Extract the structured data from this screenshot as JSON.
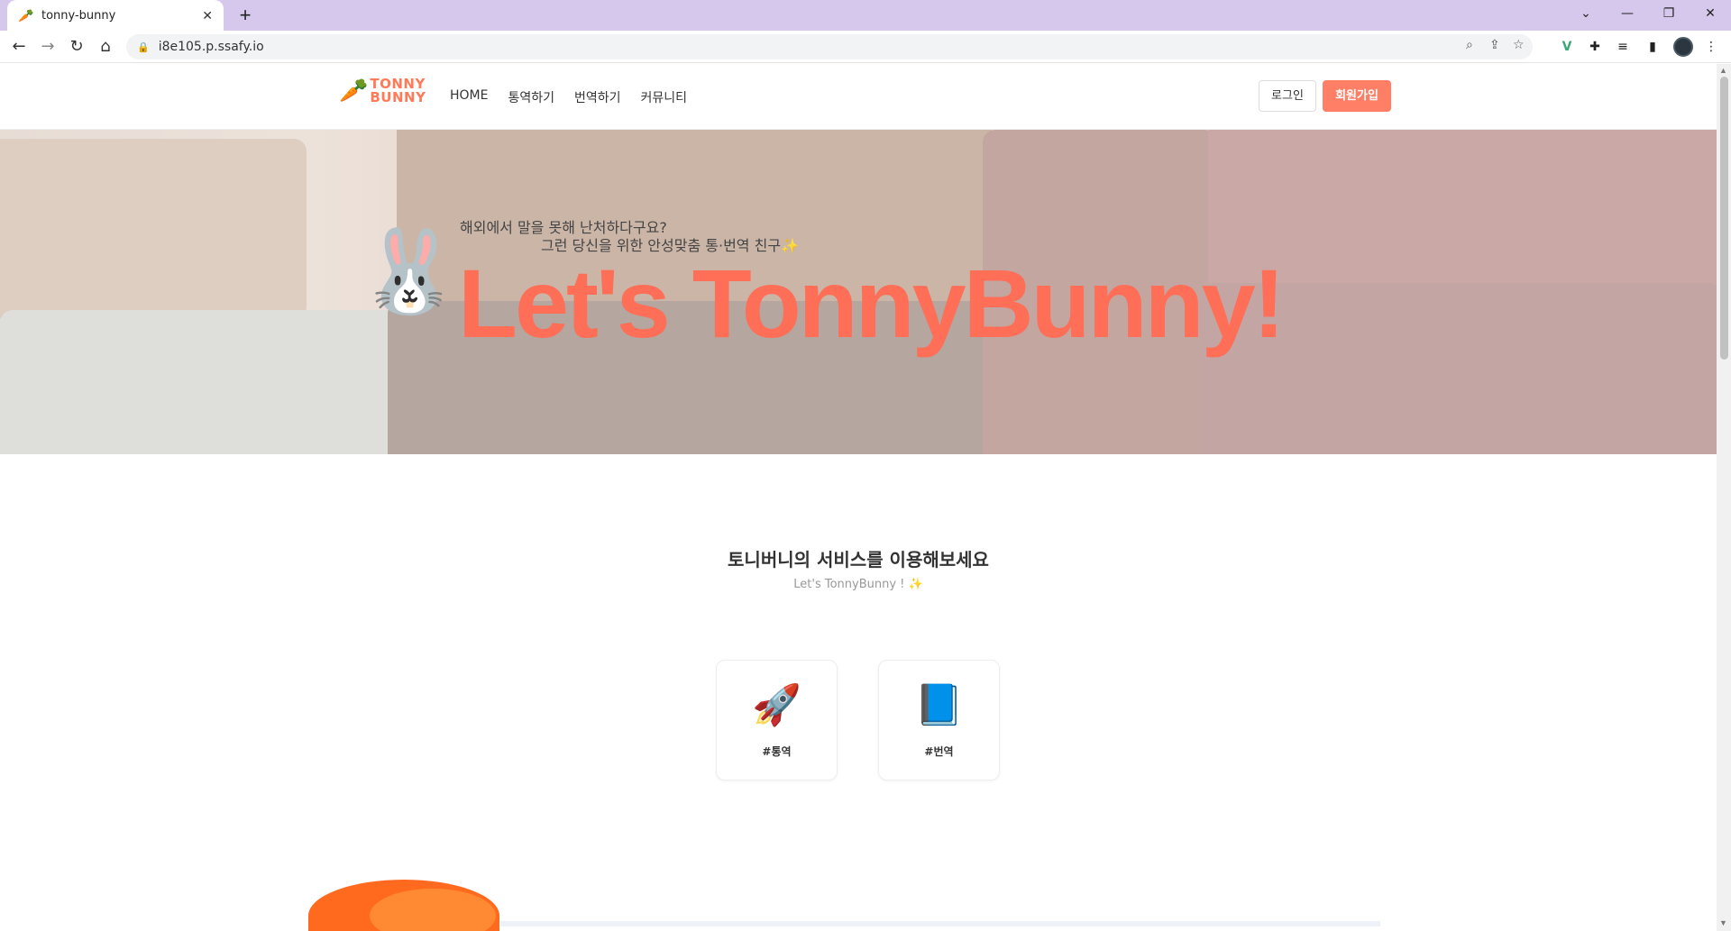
{
  "browser": {
    "tab_title": "tonny-bunny",
    "tab_favicon": "🥕",
    "url": "i8e105.p.ssafy.io"
  },
  "header": {
    "logo_line1": "TONNY",
    "logo_line2": "BUNNY",
    "nav": [
      "HOME",
      "통역하기",
      "번역하기",
      "커뮤니티"
    ],
    "login_label": "로그인",
    "signup_label": "회원가입"
  },
  "hero": {
    "subtitle1": "해외에서 말을 못해 난처하다구요?",
    "subtitle2": "그런 당신을 위한 안성맞춤 통·번역 친구✨",
    "title": "Let's TonnyBunny!",
    "bunny": "🐰"
  },
  "services": {
    "title": "토니버니의 서비스를 이용해보세요",
    "subtitle": "Let's TonnyBunny ! ✨",
    "cards": [
      {
        "icon": "🚀",
        "label": "#통역"
      },
      {
        "icon": "📘",
        "label": "#번역"
      }
    ]
  },
  "colors": {
    "brand": "#ff7f66",
    "hero_title": "#ff6e57",
    "tab_bar": "#d5c8ec"
  }
}
